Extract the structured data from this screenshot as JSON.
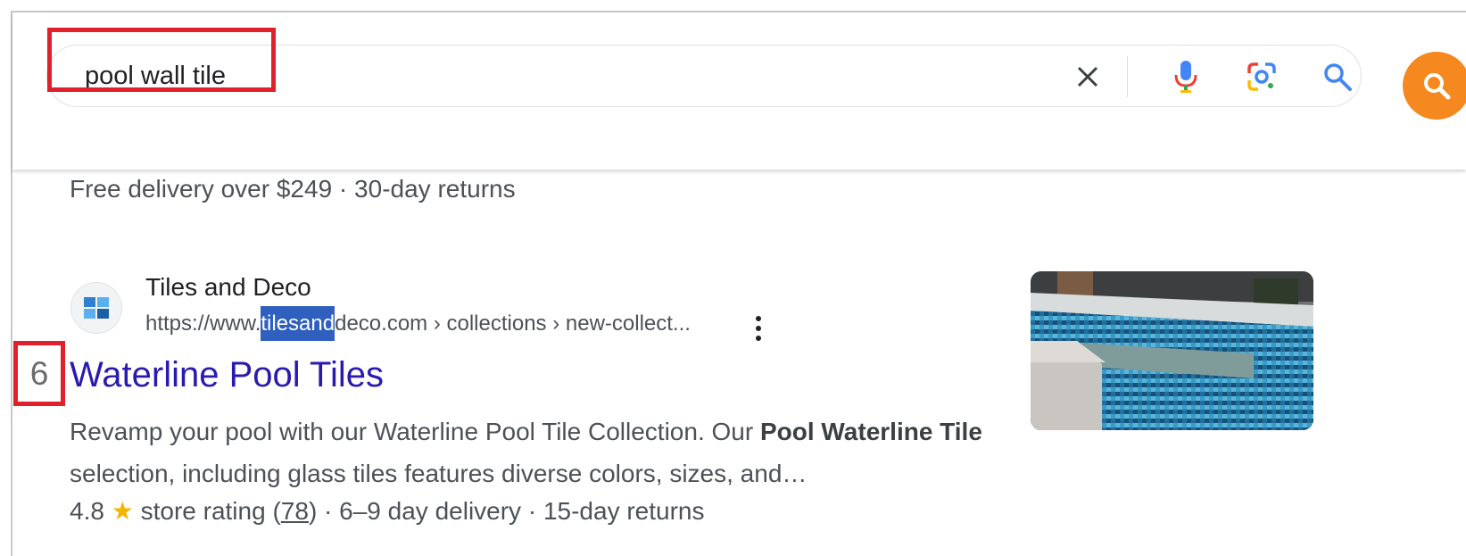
{
  "search": {
    "query": "pool wall tile",
    "clear_icon": "close-icon",
    "voice_icon": "microphone-icon",
    "lens_icon": "camera-lens-icon",
    "search_icon": "magnifier-icon"
  },
  "colors": {
    "highlight_border": "#e0202b",
    "orange_button": "#f5891f",
    "title_link": "#2a1bb0",
    "text_secondary": "#4d5156",
    "star": "#f4b400"
  },
  "previous_result": {
    "meta_delivery": "Free delivery over $249",
    "meta_separator": " · ",
    "meta_returns": "30-day returns"
  },
  "result": {
    "rank": "6",
    "site_name": "Tiles and Deco",
    "url_prefix": "https://www.",
    "url_selected": "tilesand",
    "url_suffix": "deco.com › collections › new-collect...",
    "title": "Waterline Pool Tiles",
    "snippet_part1": "Revamp your pool with our Waterline Pool Tile Collection. Our ",
    "snippet_bold1": "Pool Waterline Tile",
    "snippet_part2": " selection, including glass tiles features diverse colors, sizes, and…",
    "rating_value": "4.8",
    "rating_label": " store rating (",
    "review_count": "78",
    "rating_close": ")",
    "delivery": "6–9 day delivery",
    "returns": "15-day returns",
    "separator": " · "
  }
}
